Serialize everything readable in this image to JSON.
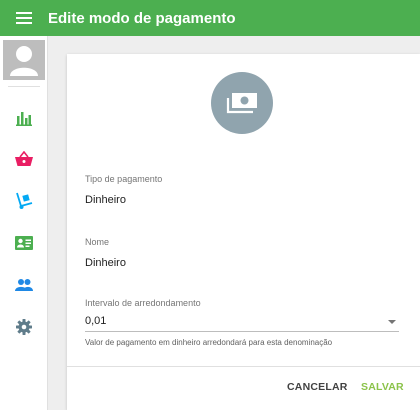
{
  "appbar": {
    "title": "Edite modo de pagamento",
    "color": "#4caf50"
  },
  "sidebar": {
    "items": [
      {
        "name": "chart-icon",
        "color": "#4caf50"
      },
      {
        "name": "basket-icon",
        "color": "#e91e63"
      },
      {
        "name": "hand-truck-icon",
        "color": "#03a9f4"
      },
      {
        "name": "id-card-icon",
        "color": "#4caf50"
      },
      {
        "name": "people-icon",
        "color": "#1e88e5"
      },
      {
        "name": "gear-icon",
        "color": "#607d8b"
      }
    ]
  },
  "form": {
    "payment_type_label": "Tipo de pagamento",
    "payment_type_value": "Dinheiro",
    "name_label": "Nome",
    "name_value": "Dinheiro",
    "rounding_label": "Intervalo de arredondamento",
    "rounding_value": "0,01",
    "rounding_helper": "Valor de pagamento em dinheiro arredondará para esta denominação"
  },
  "actions": {
    "cancel_label": "CANCELAR",
    "save_label": "SALVAR",
    "save_color": "#8bc34a"
  }
}
